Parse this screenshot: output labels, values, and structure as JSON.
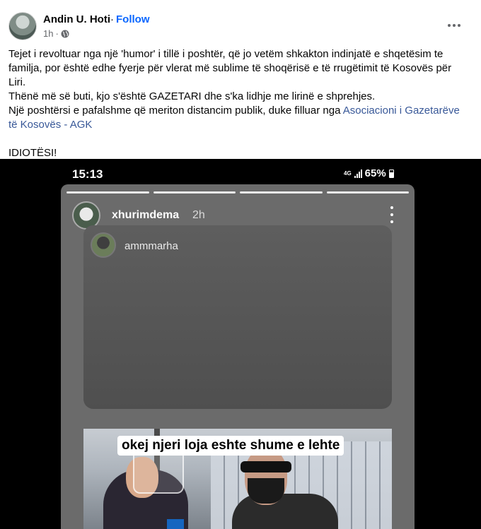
{
  "post": {
    "author": "Andin U. Hoti",
    "separator": "·",
    "follow_label": "Follow",
    "time": "1h",
    "privacy_icon": "globe-icon",
    "more_icon": "more-horizontal-icon",
    "paragraphs": [
      "Tejet i revoltuar nga një 'humor' i tillë i poshtër, që jo vetëm shkakton indinjatë e shqetësim te familja, por është edhe fyerje për vlerat më sublime të shoqërisë e të rrugëtimit të Kosovës për Liri.",
      "Thënë më së buti, kjo s'është GAZETARI dhe s'ka lidhje me lirinë e shprehjes."
    ],
    "paragraph3_text": "Një poshtërsi e pafalshme që meriton distancim publik, duke filluar nga ",
    "paragraph3_link": "Asociacioni i Gazetarëve të Kosovës - AGK",
    "closing": "IDIOTËSI!"
  },
  "screenshot": {
    "status_time": "15:13",
    "status_network": "4G",
    "battery": "65%",
    "story_user": "xhurimdema",
    "story_time": "2h",
    "shared_user": "ammmarha",
    "caption": "okej njeri loja eshte shume e lehte"
  },
  "colors": {
    "link": "#385898",
    "follow": "#0866ff",
    "secondary_text": "#65676b"
  }
}
